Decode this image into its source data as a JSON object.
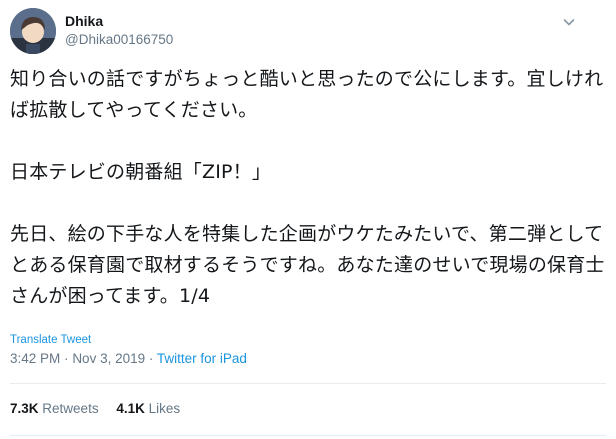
{
  "author": {
    "display_name": "Dhika",
    "handle": "@Dhika00166750"
  },
  "tweet": {
    "paragraphs": [
      "知り合いの話ですがちょっと酷いと思ったので公にします。宜しければ拡散してやってください。",
      "日本テレビの朝番組「ZIP！」",
      "先日、絵の下手な人を特集した企画がウケたみたいで、第二弾としてとある保育園で取材するそうですね。あなた達のせいで現場の保育士さんが困ってます。1/4"
    ],
    "translate_label": "Translate Tweet",
    "time": "3:42 PM",
    "separator": "·",
    "date": "Nov 3, 2019",
    "source": "Twitter for iPad"
  },
  "stats": {
    "retweets_count": "7.3K",
    "retweets_label": "Retweets",
    "likes_count": "4.1K",
    "likes_label": "Likes"
  },
  "icons": {
    "menu": "chevron-down-icon"
  },
  "colors": {
    "link": "#1b95e0",
    "secondary_text": "#657786",
    "primary_text": "#14171a",
    "divider": "#e6ecf0"
  }
}
